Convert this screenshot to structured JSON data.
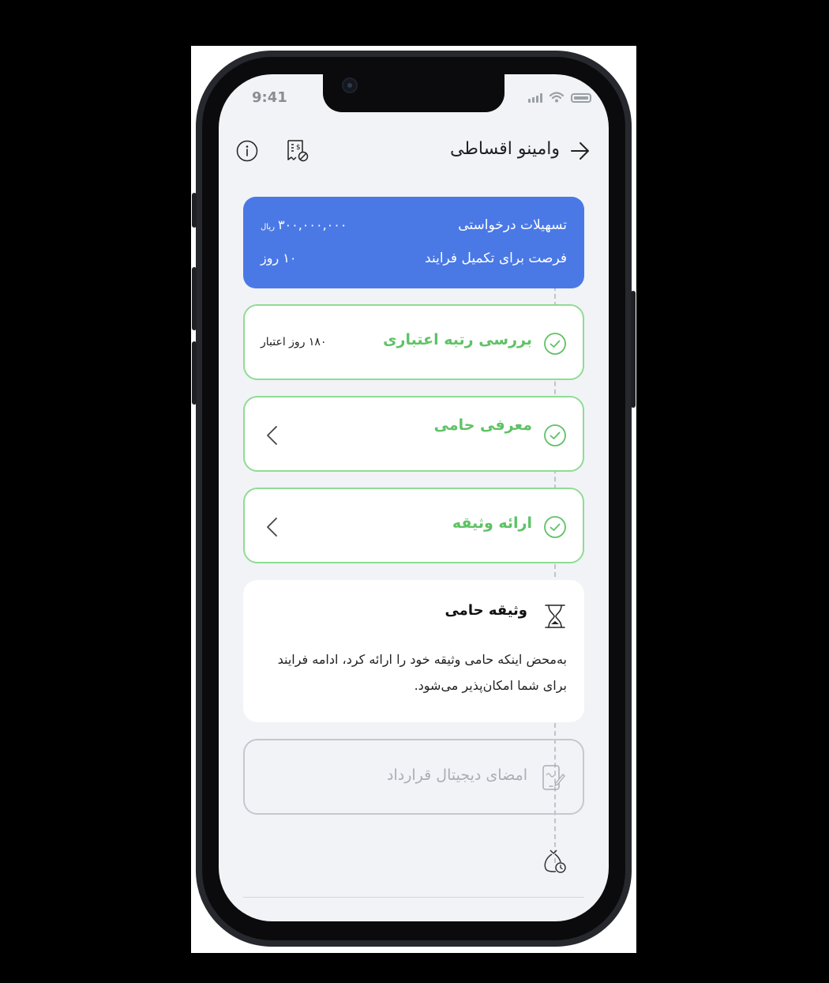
{
  "status_bar": {
    "time": "9:41"
  },
  "header": {
    "title": "وامینو اقساطی"
  },
  "summary": {
    "requested_label": "تسهیلات درخواستی",
    "requested_value": "۳۰۰,۰۰۰,۰۰۰",
    "requested_unit": "ریال",
    "deadline_label": "فرصت برای تکمیل فرایند",
    "deadline_value": "۱۰ روز"
  },
  "steps": [
    {
      "label": "بررسی رتبه اعتباری",
      "meta": "۱۸۰ روز اعتبار",
      "status": "done"
    },
    {
      "label": "معرفی حامی",
      "status": "done"
    },
    {
      "label": "ارائه وثیقه",
      "status": "done"
    }
  ],
  "note": {
    "title": "وثیقه حامی",
    "text": "به‌محض اینکه حامی وثیقه خود را ارائه کرد، ادامه فرایند برای شما امکان‌پذیر می‌شود."
  },
  "pending_step": {
    "label": "امضای دیجیتال قرارداد",
    "status": "locked"
  },
  "colors": {
    "primary": "#4a79e6",
    "success": "#5fc266",
    "success_border": "#8fdc93",
    "muted": "#a9aeb5",
    "background": "#f1f3f6"
  },
  "icons": [
    "back-arrow-icon",
    "info-icon",
    "invoice-icon",
    "check-circle-icon",
    "chevron-left-icon",
    "hourglass-icon",
    "phone-sign-icon",
    "money-bag-clock-icon"
  ]
}
